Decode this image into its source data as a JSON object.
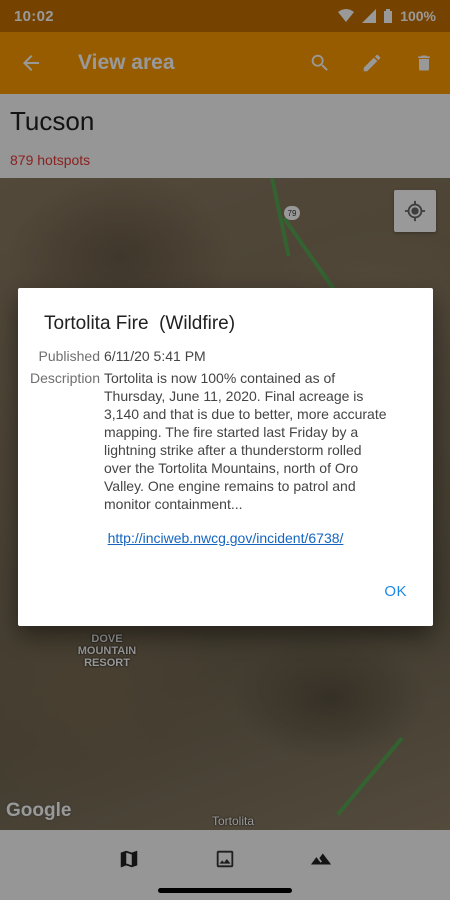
{
  "status_bar": {
    "time": "10:02",
    "battery": "100%"
  },
  "app_bar": {
    "title": "View area",
    "back_icon": "arrow-back-icon",
    "actions": [
      "search-icon",
      "edit-icon",
      "delete-icon"
    ]
  },
  "area": {
    "name": "Tucson",
    "hotspots": "879 hotspots"
  },
  "map": {
    "route_number": "79",
    "labels": {
      "resort": "DOVE\nMOUNTAIN\nRESORT",
      "place": "Tortolita",
      "attribution": "Google"
    }
  },
  "bottom_nav": [
    "map-icon",
    "image-icon",
    "terrain-icon"
  ],
  "dialog": {
    "title": "Tortolita Fire  (Wildfire)",
    "published_label": "Published",
    "published_value": "6/11/20 5:41 PM",
    "description_label": "Description",
    "description_lines": [
      "Tortolita is now 100% contained as of",
      "Thursday, June 11, 2020. Final acreage is",
      "3,140 and that is due to better, more accurate",
      "mapping. The fire started last Friday by a",
      "lightning strike after a thunderstorm rolled",
      "over the Tortolita Mountains, north of Oro",
      "Valley. One engine remains to patrol and",
      "monitor containment..."
    ],
    "link": "http://inciweb.nwcg.gov/incident/6738/",
    "ok_label": "OK"
  },
  "colors": {
    "status_bar": "#c46f00",
    "app_bar": "#fd9a00",
    "hotspots": "#e53935",
    "link": "#1565c0",
    "ok": "#1e88e5"
  }
}
